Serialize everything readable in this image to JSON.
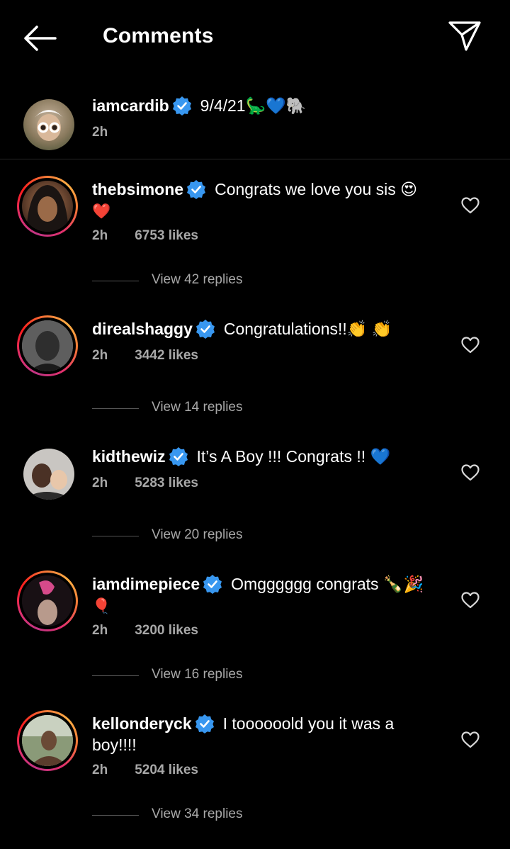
{
  "header": {
    "title": "Comments"
  },
  "caption": {
    "username": "iamcardib",
    "text": "9/4/21🦕💙🐘",
    "time": "2h"
  },
  "comments": [
    {
      "username": "thebsimone",
      "text": "Congrats we love you sis 😍",
      "text2": "❤️",
      "time": "2h",
      "likes": "6753 likes",
      "replies": "View 42 replies"
    },
    {
      "username": "direalshaggy",
      "text": "Congratulations!!👏 👏",
      "time": "2h",
      "likes": "3442 likes",
      "replies": "View 14 replies"
    },
    {
      "username": "kidthewiz",
      "text": "It’s A Boy !!! Congrats !! 💙",
      "time": "2h",
      "likes": "5283 likes",
      "replies": "View 20 replies"
    },
    {
      "username": "iamdimepiece",
      "text": "Omgggggg congrats 🍾🎉",
      "text2": "🎈",
      "time": "2h",
      "likes": "3200 likes",
      "replies": "View 16 replies"
    },
    {
      "username": "kellonderyck",
      "text": "I toooooold you it was a",
      "text2": "boy!!!!",
      "time": "2h",
      "likes": "5204 likes",
      "replies": "View 34 replies"
    }
  ],
  "colors": {
    "background": "#000000",
    "verified": "#3897f0",
    "secondary_text": "#a8a8a8"
  },
  "icons": [
    "back-arrow-icon",
    "send-icon",
    "verified-badge-icon",
    "heart-icon"
  ]
}
